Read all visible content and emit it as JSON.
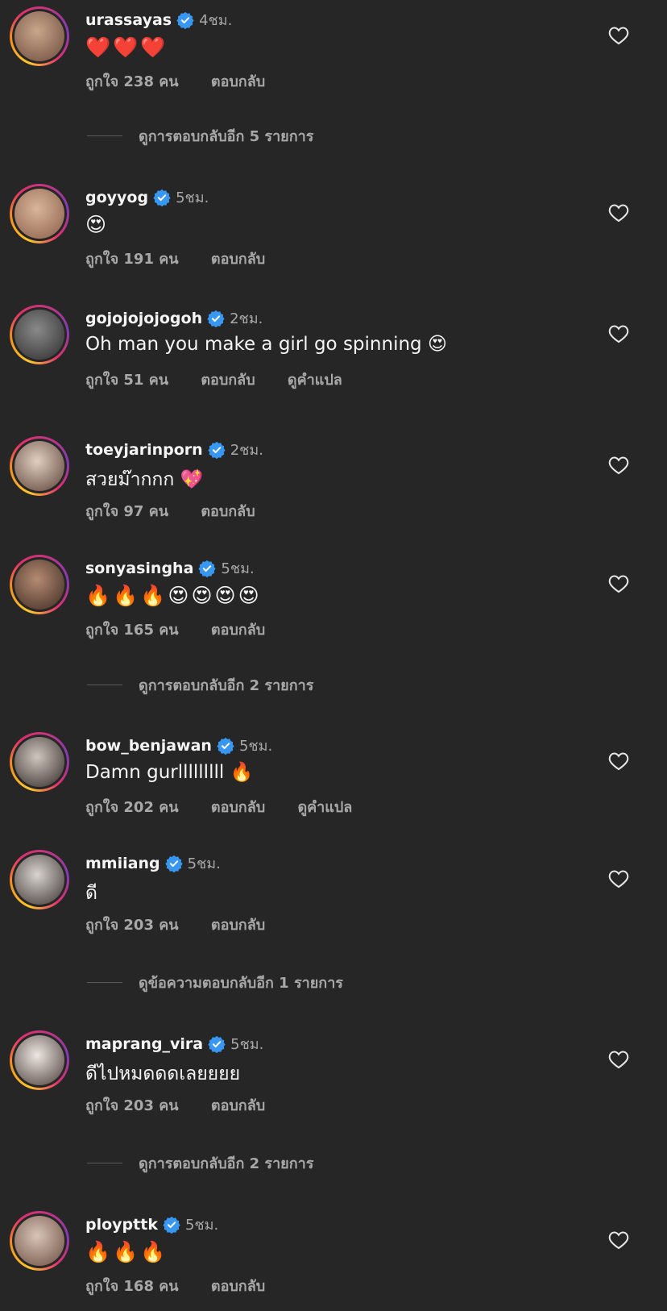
{
  "comments": [
    {
      "username": "urassayas",
      "time": "4ชม.",
      "text": "❤️❤️❤️",
      "likes": "ถูกใจ 238 คน",
      "reply": "ตอบกลับ",
      "avatar_colors": [
        "#c9a78c",
        "#6b4a3a"
      ]
    },
    {
      "username": "goyyog",
      "time": "5ชม.",
      "text": "😍",
      "likes": "ถูกใจ 191 คน",
      "reply": "ตอบกลับ",
      "avatar_colors": [
        "#d8b59a",
        "#8a5d48"
      ]
    },
    {
      "username": "gojojojojogoh",
      "time": "2ชม.",
      "text": "Oh man you make a girl go spinning 😍",
      "likes": "ถูกใจ 51 คน",
      "reply": "ตอบกลับ",
      "translate": "ดูคำแปล",
      "avatar_colors": [
        "#8a8a8a",
        "#2c2c2c"
      ]
    },
    {
      "username": "toeyjarinporn",
      "time": "2ชม.",
      "text": "สวยม๊ากกก 💖",
      "likes": "ถูกใจ 97 คน",
      "reply": "ตอบกลับ",
      "avatar_colors": [
        "#e2cfc2",
        "#5a4036"
      ]
    },
    {
      "username": "sonyasingha",
      "time": "5ชม.",
      "text": "🔥🔥🔥😍😍😍😍",
      "likes": "ถูกใจ 165 คน",
      "reply": "ตอบกลับ",
      "avatar_colors": [
        "#b58b73",
        "#3d2a22"
      ]
    },
    {
      "username": "bow_benjawan",
      "time": "5ชม.",
      "text": "Damn gurlllllllll 🔥",
      "likes": "ถูกใจ 202 คน",
      "reply": "ตอบกลับ",
      "translate": "ดูคำแปล",
      "avatar_colors": [
        "#cfc6bd",
        "#302826"
      ]
    },
    {
      "username": "mmiiang",
      "time": "5ชม.",
      "text": "ดี",
      "likes": "ถูกใจ 203 คน",
      "reply": "ตอบกลับ",
      "avatar_colors": [
        "#d9d4cf",
        "#3a3230"
      ]
    },
    {
      "username": "maprang_vira",
      "time": "5ชม.",
      "text": "ดีไปหมดดดเลยยยย",
      "likes": "ถูกใจ 203 คน",
      "reply": "ตอบกลับ",
      "avatar_colors": [
        "#ece7e3",
        "#4a3b35"
      ]
    },
    {
      "username": "ploypttk",
      "time": "5ชม.",
      "text": "🔥🔥🔥",
      "likes": "ถูกใจ 168 คน",
      "reply": "ตอบกลับ",
      "avatar_colors": [
        "#d8c5b8",
        "#6a4c3e"
      ]
    }
  ],
  "view_more": [
    "ดูการตอบกลับอีก 5 รายการ",
    "ดูการตอบกลับอีก 2 รายการ",
    "ดูข้อความตอบกลับอีก 1 รายการ",
    "ดูการตอบกลับอีก 2 รายการ"
  ],
  "colors": {
    "background": "#262626",
    "secondary_text": "#a8a8a8",
    "verified_badge": "#3897f0"
  }
}
